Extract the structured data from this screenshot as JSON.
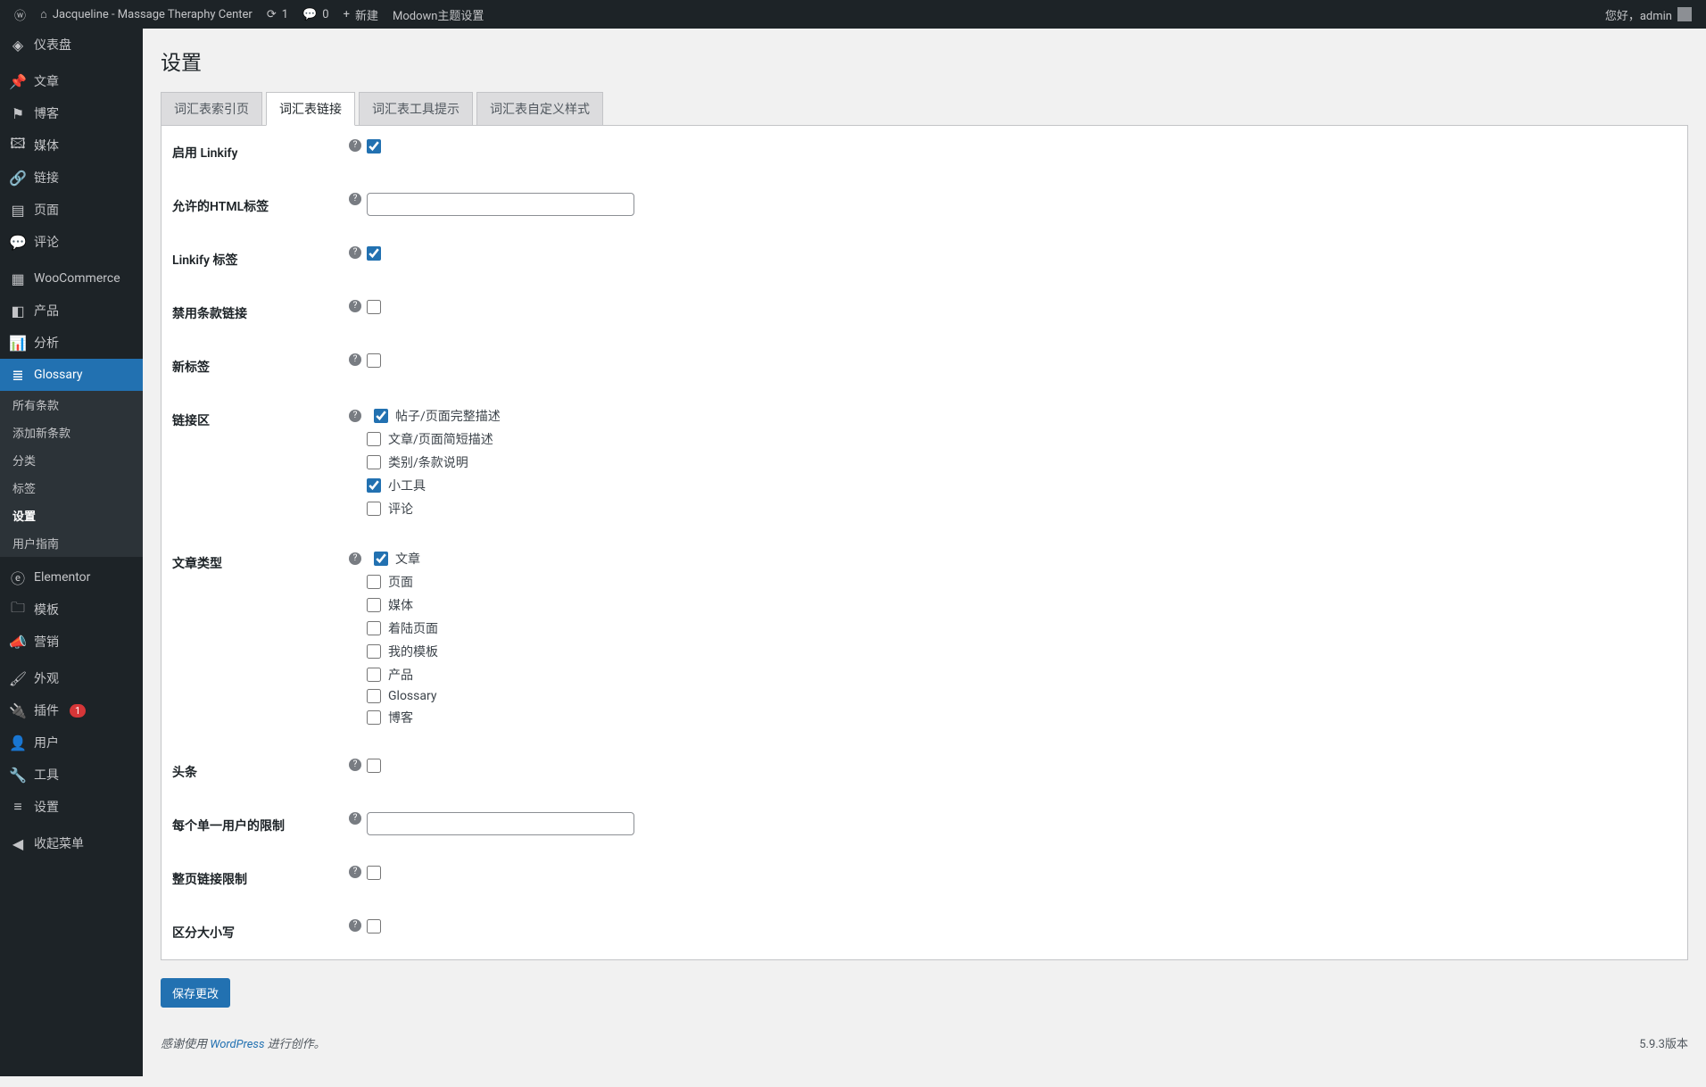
{
  "adminbar": {
    "site_name": "Jacqueline - Massage Theraphy Center",
    "updates_count": "1",
    "comments_count": "0",
    "new_label": "新建",
    "modown_label": "Modown主题设置",
    "greeting": "您好，admin"
  },
  "sidebar": {
    "dashboard": "仪表盘",
    "posts": "文章",
    "blog": "博客",
    "media": "媒体",
    "links": "链接",
    "pages": "页面",
    "comments": "评论",
    "woocommerce": "WooCommerce",
    "products": "产品",
    "analytics": "分析",
    "glossary": "Glossary",
    "glossary_sub": {
      "all_terms": "所有条款",
      "add_new": "添加新条款",
      "categories": "分类",
      "tags": "标签",
      "settings": "设置",
      "user_guide": "用户指南"
    },
    "elementor": "Elementor",
    "templates": "模板",
    "marketing": "营销",
    "appearance": "外观",
    "plugins": "插件",
    "plugins_count": "1",
    "users": "用户",
    "tools": "工具",
    "settings_menu": "设置",
    "collapse": "收起菜单"
  },
  "page": {
    "title": "设置",
    "tabs": {
      "index": "词汇表索引页",
      "links": "词汇表链接",
      "tooltip": "词汇表工具提示",
      "custom": "词汇表自定义样式"
    },
    "fields": {
      "enable_linkify": "启用 Linkify",
      "allowed_html": "允许的HTML标签",
      "linkify_tags": "Linkify 标签",
      "disable_term_links": "禁用条款链接",
      "new_tab": "新标签",
      "link_zones": "链接区",
      "zone_full": "帖子/页面完整描述",
      "zone_excerpt": "文章/页面简短描述",
      "zone_category": "类别/条款说明",
      "zone_widget": "小工具",
      "zone_comment": "评论",
      "post_types": "文章类型",
      "pt_post": "文章",
      "pt_page": "页面",
      "pt_media": "媒体",
      "pt_landing": "着陆页面",
      "pt_template": "我的模板",
      "pt_product": "产品",
      "pt_glossary": "Glossary",
      "pt_blog": "博客",
      "headline": "头条",
      "user_limit": "每个单一用户的限制",
      "page_link_limit": "整页链接限制",
      "case_sensitive": "区分大小写"
    },
    "save_button": "保存更改"
  },
  "footer": {
    "thank_prefix": "感谢使用 ",
    "wordpress": "WordPress",
    "thank_suffix": " 进行创作。",
    "version": "5.9.3版本"
  }
}
